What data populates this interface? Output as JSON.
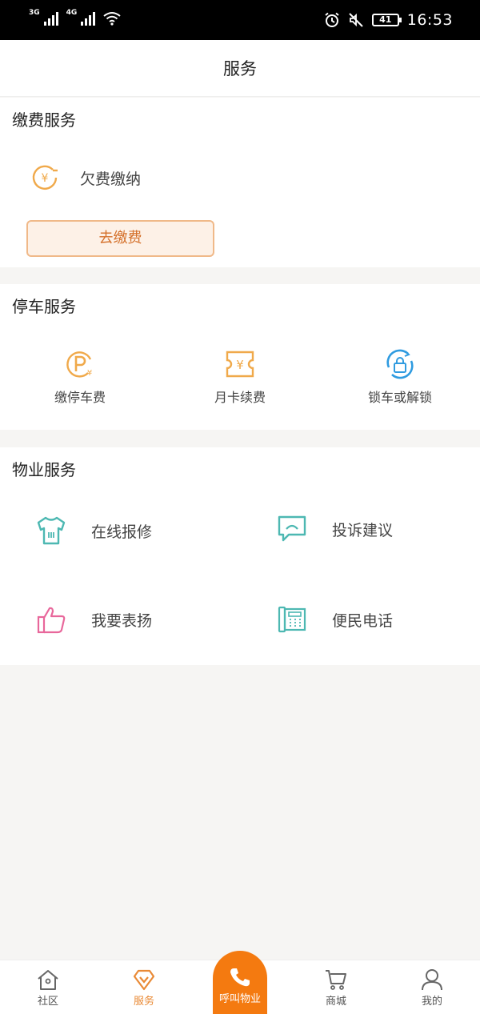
{
  "status_bar": {
    "network1": "3G",
    "network2": "4G",
    "battery": "41",
    "time": "16:53"
  },
  "header": {
    "title": "服务"
  },
  "payment": {
    "title": "缴费服务",
    "arrears_label": "欠费缴纳",
    "pay_button": "去缴费"
  },
  "parking": {
    "title": "停车服务",
    "items": [
      {
        "label": "缴停车费",
        "icon": "parking-fee-icon"
      },
      {
        "label": "月卡续费",
        "icon": "monthly-card-icon"
      },
      {
        "label": "锁车或解锁",
        "icon": "lock-car-icon"
      }
    ]
  },
  "property": {
    "title": "物业服务",
    "items": [
      {
        "label": "在线报修",
        "icon": "repair-shirt-icon"
      },
      {
        "label": "投诉建议",
        "icon": "chat-bubble-icon"
      },
      {
        "label": "我要表扬",
        "icon": "thumbs-up-icon"
      },
      {
        "label": "便民电话",
        "icon": "telephone-icon"
      }
    ]
  },
  "tabs": [
    {
      "label": "社区",
      "icon": "house-icon"
    },
    {
      "label": "服务",
      "icon": "diamond-icon",
      "active": true
    },
    {
      "label": "呼叫物业",
      "icon": "phone-icon"
    },
    {
      "label": "商城",
      "icon": "cart-icon"
    },
    {
      "label": "我的",
      "icon": "user-icon"
    }
  ],
  "colors": {
    "accent": "#f47a10",
    "pay_text": "#d4702a",
    "teal": "#4db8b2",
    "pink": "#e8679b",
    "parking_yellow": "#f0a94a",
    "lock_blue": "#2f9be0"
  }
}
